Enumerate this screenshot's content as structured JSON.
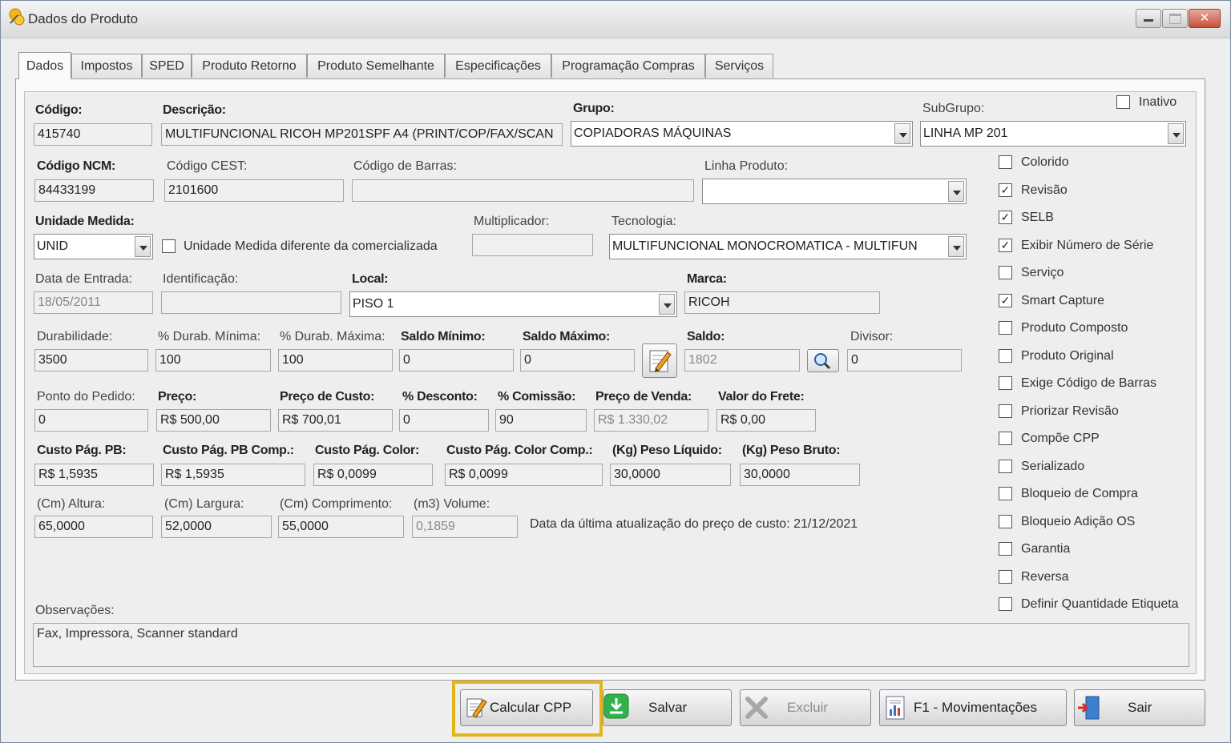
{
  "window": {
    "title": "Dados do Produto",
    "close_glyph": "✕"
  },
  "tabs": [
    "Dados",
    "Impostos",
    "SPED",
    "Produto Retorno",
    "Produto Semelhante",
    "Especificações",
    "Programação Compras",
    "Serviços"
  ],
  "form": {
    "codigo": {
      "label": "Código:",
      "value": "415740"
    },
    "descricao": {
      "label": "Descrição:",
      "value": "MULTIFUNCIONAL RICOH MP201SPF A4 (PRINT/COP/FAX/SCAN"
    },
    "grupo": {
      "label": "Grupo:",
      "value": "COPIADORAS MÁQUINAS"
    },
    "subgrupo": {
      "label": "SubGrupo:",
      "value": "LINHA MP 201"
    },
    "codigo_ncm": {
      "label": "Código NCM:",
      "value": "84433199"
    },
    "codigo_cest": {
      "label": "Código CEST:",
      "value": "2101600"
    },
    "codigo_barras": {
      "label": "Código de Barras:",
      "value": ""
    },
    "linha_produto": {
      "label": "Linha Produto:",
      "value": ""
    },
    "unidade_medida": {
      "label": "Unidade Medida:",
      "value": "UNID"
    },
    "unidade_diferente": {
      "label": "Unidade Medida diferente da comercializada",
      "checked": false
    },
    "multiplicador": {
      "label": "Multiplicador:",
      "value": ""
    },
    "tecnologia": {
      "label": "Tecnologia:",
      "value": "MULTIFUNCIONAL MONOCROMATICA - MULTIFUN"
    },
    "data_entrada": {
      "label": "Data de Entrada:",
      "value": "18/05/2011"
    },
    "identificacao": {
      "label": "Identificação:",
      "value": ""
    },
    "local": {
      "label": "Local:",
      "value": "PISO 1"
    },
    "marca": {
      "label": "Marca:",
      "value": "RICOH"
    },
    "durabilidade": {
      "label": "Durabilidade:",
      "value": "3500"
    },
    "durab_minima": {
      "label": "% Durab. Mínima:",
      "value": "100"
    },
    "durab_maxima": {
      "label": "% Durab. Máxima:",
      "value": "100"
    },
    "saldo_minimo": {
      "label": "Saldo Mínimo:",
      "value": "0"
    },
    "saldo_maximo": {
      "label": "Saldo Máximo:",
      "value": "0"
    },
    "saldo": {
      "label": "Saldo:",
      "value": "1802"
    },
    "divisor": {
      "label": "Divisor:",
      "value": "0"
    },
    "ponto_pedido": {
      "label": "Ponto do Pedido:",
      "value": "0"
    },
    "preco": {
      "label": "Preço:",
      "value": "R$ 500,00"
    },
    "preco_custo": {
      "label": "Preço de Custo:",
      "value": "R$ 700,01"
    },
    "desconto": {
      "label": "% Desconto:",
      "value": "0"
    },
    "comissao": {
      "label": "% Comissão:",
      "value": "90"
    },
    "preco_venda": {
      "label": "Preço de Venda:",
      "value": "R$ 1.330,02"
    },
    "valor_frete": {
      "label": "Valor do Frete:",
      "value": "R$ 0,00"
    },
    "custo_pb": {
      "label": "Custo Pág. PB:",
      "value": "R$ 1,5935"
    },
    "custo_pb_comp": {
      "label": "Custo Pág. PB Comp.:",
      "value": "R$ 1,5935"
    },
    "custo_color": {
      "label": "Custo Pág. Color:",
      "value": "R$ 0,0099"
    },
    "custo_color_comp": {
      "label": "Custo Pág. Color Comp.:",
      "value": "R$ 0,0099"
    },
    "peso_liquido": {
      "label": "(Kg) Peso Líquido:",
      "value": "30,0000"
    },
    "peso_bruto": {
      "label": "(Kg) Peso Bruto:",
      "value": "30,0000"
    },
    "altura": {
      "label": "(Cm) Altura:",
      "value": "65,0000"
    },
    "largura": {
      "label": "(Cm) Largura:",
      "value": "52,0000"
    },
    "comprimento": {
      "label": "(Cm) Comprimento:",
      "value": "55,0000"
    },
    "volume": {
      "label": "(m3) Volume:",
      "value": "0,1859"
    },
    "ultima_atualizacao": "Data da última atualização do preço de custo: 21/12/2021",
    "observacoes": {
      "label": "Observações:",
      "value": "Fax, Impressora, Scanner standard"
    }
  },
  "inativo": {
    "label": "Inativo",
    "checked": false
  },
  "flags": [
    {
      "label": "Colorido",
      "checked": false
    },
    {
      "label": "Revisão",
      "checked": true
    },
    {
      "label": "SELB",
      "checked": true
    },
    {
      "label": "Exibir Número de Série",
      "checked": true
    },
    {
      "label": "Serviço",
      "checked": false
    },
    {
      "label": "Smart Capture",
      "checked": true
    },
    {
      "label": "Produto Composto",
      "checked": false
    },
    {
      "label": "Produto Original",
      "checked": false
    },
    {
      "label": "Exige Código de Barras",
      "checked": false
    },
    {
      "label": "Priorizar Revisão",
      "checked": false
    },
    {
      "label": "Compõe CPP",
      "checked": false
    },
    {
      "label": "Serializado",
      "checked": false
    },
    {
      "label": "Bloqueio de Compra",
      "checked": false
    },
    {
      "label": "Bloqueio Adição OS",
      "checked": false
    },
    {
      "label": "Garantia",
      "checked": false
    },
    {
      "label": "Reversa",
      "checked": false
    },
    {
      "label": "Definir Quantidade Etiqueta",
      "checked": false
    }
  ],
  "buttons": {
    "calcular_cpp": "Calcular CPP",
    "salvar": "Salvar",
    "excluir": "Excluir",
    "movimentacoes": "F1 - Movimentações",
    "sair": "Sair"
  },
  "colors": {
    "highlight": "#e2b51b",
    "save_green": "#2fb34a"
  },
  "icons": [
    "app-icon",
    "calculator-edit-icon",
    "search-magnifier-icon",
    "pencil-edit-icon",
    "save-download-icon",
    "delete-x-icon",
    "report-chart-icon",
    "exit-door-icon"
  ]
}
